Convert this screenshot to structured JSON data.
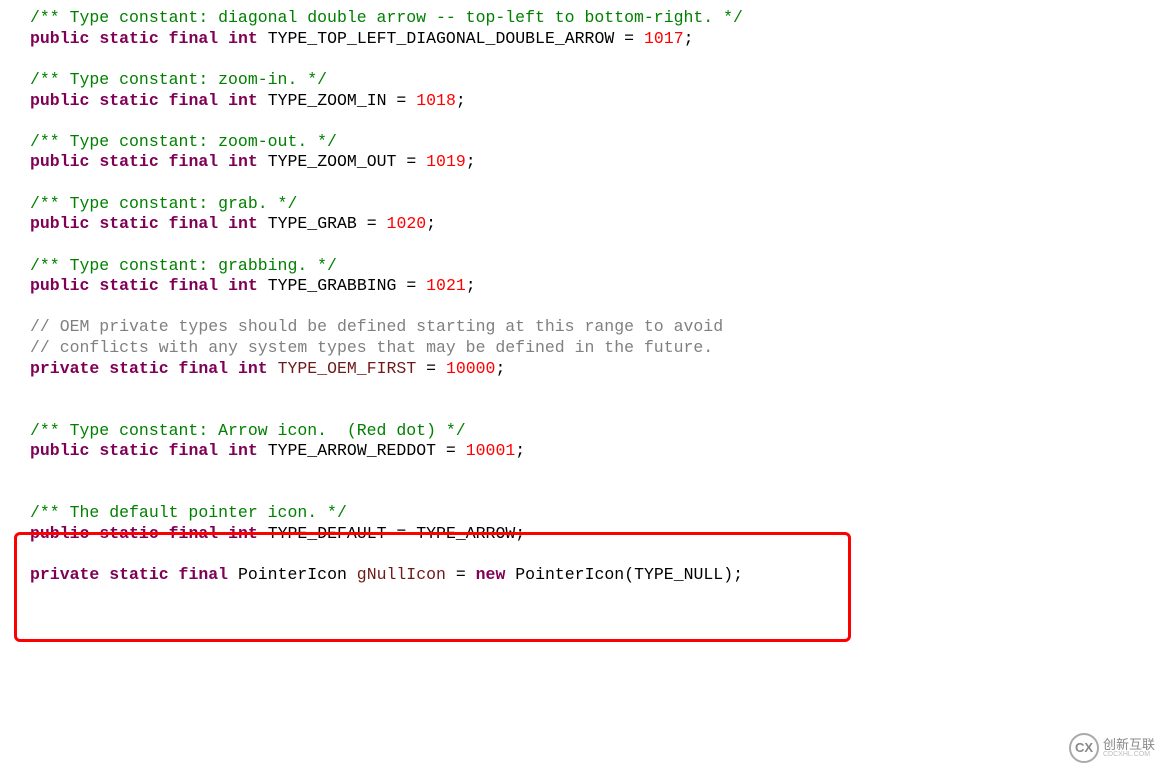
{
  "lines": [
    {
      "type": "doc-comment",
      "text": "/** Type constant: diagonal double arrow -- top-left to bottom-right. */"
    },
    {
      "type": "decl",
      "modifiers": "public static final",
      "vtype": "int",
      "name": "TYPE_TOP_LEFT_DIAGONAL_DOUBLE_ARROW",
      "value": "1017"
    },
    {
      "type": "blank"
    },
    {
      "type": "doc-comment",
      "text": "/** Type constant: zoom-in. */"
    },
    {
      "type": "decl",
      "modifiers": "public static final",
      "vtype": "int",
      "name": "TYPE_ZOOM_IN",
      "value": "1018"
    },
    {
      "type": "blank"
    },
    {
      "type": "doc-comment",
      "text": "/** Type constant: zoom-out. */"
    },
    {
      "type": "decl",
      "modifiers": "public static final",
      "vtype": "int",
      "name": "TYPE_ZOOM_OUT",
      "value": "1019"
    },
    {
      "type": "blank"
    },
    {
      "type": "doc-comment",
      "text": "/** Type constant: grab. */"
    },
    {
      "type": "decl",
      "modifiers": "public static final",
      "vtype": "int",
      "name": "TYPE_GRAB",
      "value": "1020"
    },
    {
      "type": "blank"
    },
    {
      "type": "doc-comment",
      "text": "/** Type constant: grabbing. */"
    },
    {
      "type": "decl",
      "modifiers": "public static final",
      "vtype": "int",
      "name": "TYPE_GRABBING",
      "value": "1021"
    },
    {
      "type": "blank"
    },
    {
      "type": "line-comment",
      "text": "// OEM private types should be defined starting at this range to avoid"
    },
    {
      "type": "line-comment",
      "text": "// conflicts with any system types that may be defined in the future."
    },
    {
      "type": "decl",
      "modifiers": "private static final",
      "vtype": "int",
      "name": "TYPE_OEM_FIRST",
      "value": "10000",
      "darkred": true
    },
    {
      "type": "blank"
    },
    {
      "type": "blank"
    },
    {
      "type": "doc-comment",
      "text": "/** Type constant: Arrow icon.  (Red dot) */"
    },
    {
      "type": "decl",
      "modifiers": "public static final",
      "vtype": "int",
      "name": "TYPE_ARROW_REDDOT",
      "value": "10001"
    },
    {
      "type": "blank"
    },
    {
      "type": "blank"
    },
    {
      "type": "doc-comment",
      "text": "/** The default pointer icon. */"
    },
    {
      "type": "decl-ident",
      "modifiers": "public static final",
      "vtype": "int",
      "name": "TYPE_DEFAULT",
      "value": "TYPE_ARROW"
    },
    {
      "type": "blank"
    },
    {
      "type": "decl-new",
      "modifiers": "private static final",
      "vtype": "PointerIcon",
      "name": "gNullIcon",
      "new_kw": "new",
      "ctor": "PointerIcon",
      "arg": "TYPE_NULL"
    }
  ],
  "watermark": {
    "brand": "创新互联",
    "sub": "CDCXHL.COM",
    "glyph": "CX"
  }
}
